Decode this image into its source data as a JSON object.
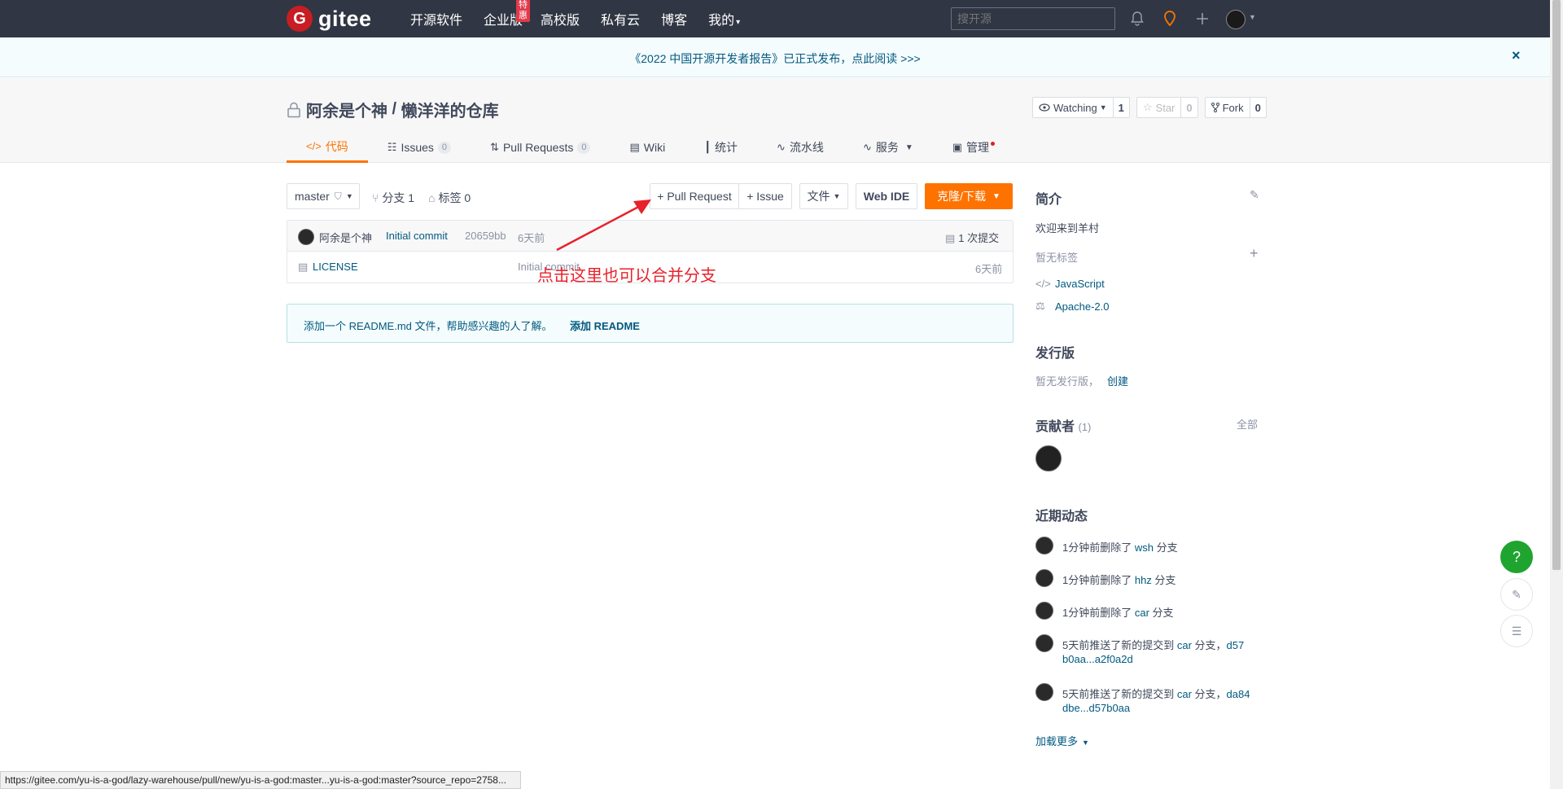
{
  "topnav": {
    "logo_text": "gitee",
    "logo_letter": "G",
    "links": [
      "开源软件",
      "企业版",
      "高校版",
      "私有云",
      "博客",
      "我的"
    ],
    "enterprise_badge": "特惠",
    "search_placeholder": "搜开源"
  },
  "banner": {
    "text": "《2022 中国开源开发者报告》已正式发布，点此阅读 >>>",
    "close": "×"
  },
  "repo": {
    "owner": "阿余是个神",
    "sep": " / ",
    "name": "懒洋洋的仓库",
    "watch_label": "Watching",
    "watch_count": "1",
    "star_label": "Star",
    "star_count": "0",
    "fork_label": "Fork",
    "fork_count": "0"
  },
  "tabs": [
    {
      "label": "代码"
    },
    {
      "label": "Issues",
      "count": "0"
    },
    {
      "label": "Pull Requests",
      "count": "0"
    },
    {
      "label": "Wiki"
    },
    {
      "label": "统计"
    },
    {
      "label": "流水线"
    },
    {
      "label": "服务"
    },
    {
      "label": "管理"
    }
  ],
  "toolbar": {
    "branch": "master",
    "branches": "分支 1",
    "tags": "标签 0",
    "pull_request": "+ Pull Request",
    "issue": "+ Issue",
    "file": "文件",
    "web_ide": "Web IDE",
    "clone": "克隆/下载"
  },
  "commit": {
    "author": "阿余是个神",
    "message": "Initial commit",
    "hash": "20659bb",
    "time": "6天前",
    "count": "1 次提交"
  },
  "files": [
    {
      "name": "LICENSE",
      "message": "Initial commit",
      "time": "6天前"
    }
  ],
  "readme": {
    "text": "添加一个 README.md 文件，帮助感兴趣的人了解。",
    "link": "添加 README"
  },
  "annotation": "点击这里也可以合并分支",
  "sidebar": {
    "intro_title": "简介",
    "intro_text": "欢迎来到羊村",
    "no_tags": "暂无标签",
    "language": "JavaScript",
    "license": "Apache-2.0",
    "release_title": "发行版",
    "no_release": "暂无发行版，",
    "create": "创建",
    "contributors_title": "贡献者",
    "contributors_count": "(1)",
    "all": "全部",
    "activity_title": "近期动态",
    "activities": [
      {
        "pre": "1分钟前删除了 ",
        "link": "wsh",
        "post": " 分支"
      },
      {
        "pre": "1分钟前删除了 ",
        "link": "hhz",
        "post": " 分支"
      },
      {
        "pre": "1分钟前删除了 ",
        "link": "car",
        "post": " 分支"
      }
    ],
    "push1": {
      "pre": "5天前推送了新的提交到 ",
      "link": "car",
      "post": " 分支，",
      "range_a": "d57",
      "range_b": "b0aa...a2f0a2d"
    },
    "push2": {
      "pre": "5天前推送了新的提交到 ",
      "link": "car",
      "post": " 分支，",
      "range_a": "da84",
      "range_b": "dbe...d57b0aa"
    },
    "load_more": "加载更多"
  },
  "float": {
    "help": "?"
  },
  "statusbar": "https://gitee.com/yu-is-a-god/lazy-warehouse/pull/new/yu-is-a-god:master...yu-is-a-god:master?source_repo=2758...",
  "colors": {
    "accent": "#fe7300",
    "link": "#005980",
    "nav": "#303643",
    "brand": "#c71d23",
    "annotation": "#e8212b"
  }
}
